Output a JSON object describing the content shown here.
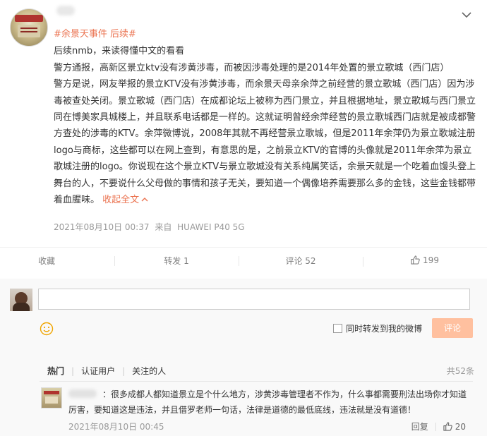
{
  "post": {
    "topic": "#余景天事件 后续#",
    "paragraphs": [
      "后续nmb，来读得懂中文的看看",
      "警方通报，高新区景立ktv没有涉黄涉毒，而被因涉毒处理的是2014年处置的景立歌城（西门店）",
      "警方是说，网友举报的景立KTV没有涉黄涉毒，而余景天母亲余萍之前经营的景立歌城（西门店）因为涉毒被查处关闭。景立歌城（西门店）在成都论坛上被称为西门景立，并且根据地址，景立歌城与西门景立同在博美家具城楼上，并且联系电话都是一样的。这就证明曾经余萍经营的景立歌城西门店就是被成都警方查处的涉毒的KTV。余萍微博说，2008年其就不再经营景立歌城，但是2011年余萍仍为景立歌城注册logo与商标，这些都可以在网上查到，有意思的是，之前景立KTV的官博的头像就是2011年余萍为景立歌城注册的logo。你说现在这个景立KTV与景立歌城没有关系纯属笑话，余景天就是一个吃着血馒头登上舞台的人，不要说什么父母做的事情和孩子无关，要知道一个偶像培养需要那么多的金钱，这些金钱都带着血腥味。"
    ],
    "collapse_label": "收起全文",
    "meta": {
      "timestamp": "2021年08月10日 00:37",
      "source_prefix": "来自",
      "device": "HUAWEI P40 5G"
    }
  },
  "actions": {
    "favorite": "收藏",
    "forward": "转发 1",
    "comment": "评论 52",
    "like_count": "199"
  },
  "comment_box": {
    "placeholder": "",
    "forward_label": "同时转发到我的微博",
    "submit_label": "评论"
  },
  "comment_tabs": {
    "items": [
      "热门",
      "认证用户",
      "关注的人"
    ],
    "total": "共52条"
  },
  "reply": {
    "text": "：很多成都人都知道景立是个什么地方，涉黄涉毒管理者不作为，什么事都需要刑法出场你才知道厉害，要知道这是违法，并且借罗老师一句话，法律是道德的最低底线，违法就是没有道德！",
    "timestamp": "2021年08月10日 00:45",
    "reply_label": "回复",
    "like_count": "20"
  },
  "colors": {
    "accent": "#eb7350",
    "submit_disabled": "#ffc09f"
  },
  "icons": [
    "chevron-down-icon",
    "like-icon",
    "emoji-icon"
  ]
}
